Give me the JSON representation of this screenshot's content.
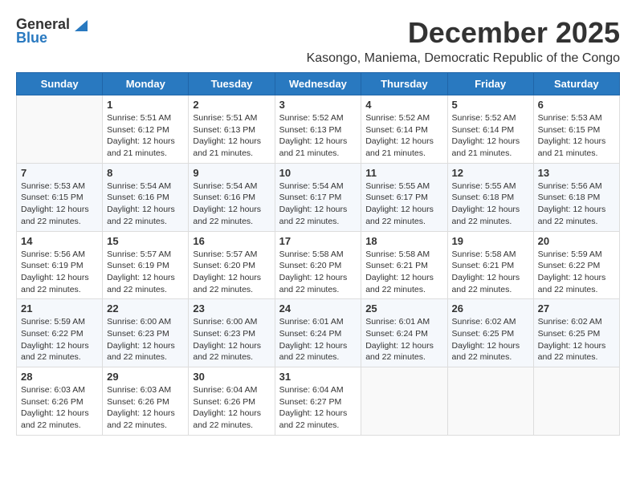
{
  "header": {
    "logo_general": "General",
    "logo_blue": "Blue",
    "month_title": "December 2025",
    "subtitle": "Kasongo, Maniema, Democratic Republic of the Congo"
  },
  "days_of_week": [
    "Sunday",
    "Monday",
    "Tuesday",
    "Wednesday",
    "Thursday",
    "Friday",
    "Saturday"
  ],
  "weeks": [
    [
      {
        "day": "",
        "text": ""
      },
      {
        "day": "1",
        "text": "Sunrise: 5:51 AM\nSunset: 6:12 PM\nDaylight: 12 hours\nand 21 minutes."
      },
      {
        "day": "2",
        "text": "Sunrise: 5:51 AM\nSunset: 6:13 PM\nDaylight: 12 hours\nand 21 minutes."
      },
      {
        "day": "3",
        "text": "Sunrise: 5:52 AM\nSunset: 6:13 PM\nDaylight: 12 hours\nand 21 minutes."
      },
      {
        "day": "4",
        "text": "Sunrise: 5:52 AM\nSunset: 6:14 PM\nDaylight: 12 hours\nand 21 minutes."
      },
      {
        "day": "5",
        "text": "Sunrise: 5:52 AM\nSunset: 6:14 PM\nDaylight: 12 hours\nand 21 minutes."
      },
      {
        "day": "6",
        "text": "Sunrise: 5:53 AM\nSunset: 6:15 PM\nDaylight: 12 hours\nand 21 minutes."
      }
    ],
    [
      {
        "day": "7",
        "text": "Sunrise: 5:53 AM\nSunset: 6:15 PM\nDaylight: 12 hours\nand 22 minutes."
      },
      {
        "day": "8",
        "text": "Sunrise: 5:54 AM\nSunset: 6:16 PM\nDaylight: 12 hours\nand 22 minutes."
      },
      {
        "day": "9",
        "text": "Sunrise: 5:54 AM\nSunset: 6:16 PM\nDaylight: 12 hours\nand 22 minutes."
      },
      {
        "day": "10",
        "text": "Sunrise: 5:54 AM\nSunset: 6:17 PM\nDaylight: 12 hours\nand 22 minutes."
      },
      {
        "day": "11",
        "text": "Sunrise: 5:55 AM\nSunset: 6:17 PM\nDaylight: 12 hours\nand 22 minutes."
      },
      {
        "day": "12",
        "text": "Sunrise: 5:55 AM\nSunset: 6:18 PM\nDaylight: 12 hours\nand 22 minutes."
      },
      {
        "day": "13",
        "text": "Sunrise: 5:56 AM\nSunset: 6:18 PM\nDaylight: 12 hours\nand 22 minutes."
      }
    ],
    [
      {
        "day": "14",
        "text": "Sunrise: 5:56 AM\nSunset: 6:19 PM\nDaylight: 12 hours\nand 22 minutes."
      },
      {
        "day": "15",
        "text": "Sunrise: 5:57 AM\nSunset: 6:19 PM\nDaylight: 12 hours\nand 22 minutes."
      },
      {
        "day": "16",
        "text": "Sunrise: 5:57 AM\nSunset: 6:20 PM\nDaylight: 12 hours\nand 22 minutes."
      },
      {
        "day": "17",
        "text": "Sunrise: 5:58 AM\nSunset: 6:20 PM\nDaylight: 12 hours\nand 22 minutes."
      },
      {
        "day": "18",
        "text": "Sunrise: 5:58 AM\nSunset: 6:21 PM\nDaylight: 12 hours\nand 22 minutes."
      },
      {
        "day": "19",
        "text": "Sunrise: 5:58 AM\nSunset: 6:21 PM\nDaylight: 12 hours\nand 22 minutes."
      },
      {
        "day": "20",
        "text": "Sunrise: 5:59 AM\nSunset: 6:22 PM\nDaylight: 12 hours\nand 22 minutes."
      }
    ],
    [
      {
        "day": "21",
        "text": "Sunrise: 5:59 AM\nSunset: 6:22 PM\nDaylight: 12 hours\nand 22 minutes."
      },
      {
        "day": "22",
        "text": "Sunrise: 6:00 AM\nSunset: 6:23 PM\nDaylight: 12 hours\nand 22 minutes."
      },
      {
        "day": "23",
        "text": "Sunrise: 6:00 AM\nSunset: 6:23 PM\nDaylight: 12 hours\nand 22 minutes."
      },
      {
        "day": "24",
        "text": "Sunrise: 6:01 AM\nSunset: 6:24 PM\nDaylight: 12 hours\nand 22 minutes."
      },
      {
        "day": "25",
        "text": "Sunrise: 6:01 AM\nSunset: 6:24 PM\nDaylight: 12 hours\nand 22 minutes."
      },
      {
        "day": "26",
        "text": "Sunrise: 6:02 AM\nSunset: 6:25 PM\nDaylight: 12 hours\nand 22 minutes."
      },
      {
        "day": "27",
        "text": "Sunrise: 6:02 AM\nSunset: 6:25 PM\nDaylight: 12 hours\nand 22 minutes."
      }
    ],
    [
      {
        "day": "28",
        "text": "Sunrise: 6:03 AM\nSunset: 6:26 PM\nDaylight: 12 hours\nand 22 minutes."
      },
      {
        "day": "29",
        "text": "Sunrise: 6:03 AM\nSunset: 6:26 PM\nDaylight: 12 hours\nand 22 minutes."
      },
      {
        "day": "30",
        "text": "Sunrise: 6:04 AM\nSunset: 6:26 PM\nDaylight: 12 hours\nand 22 minutes."
      },
      {
        "day": "31",
        "text": "Sunrise: 6:04 AM\nSunset: 6:27 PM\nDaylight: 12 hours\nand 22 minutes."
      },
      {
        "day": "",
        "text": ""
      },
      {
        "day": "",
        "text": ""
      },
      {
        "day": "",
        "text": ""
      }
    ]
  ]
}
